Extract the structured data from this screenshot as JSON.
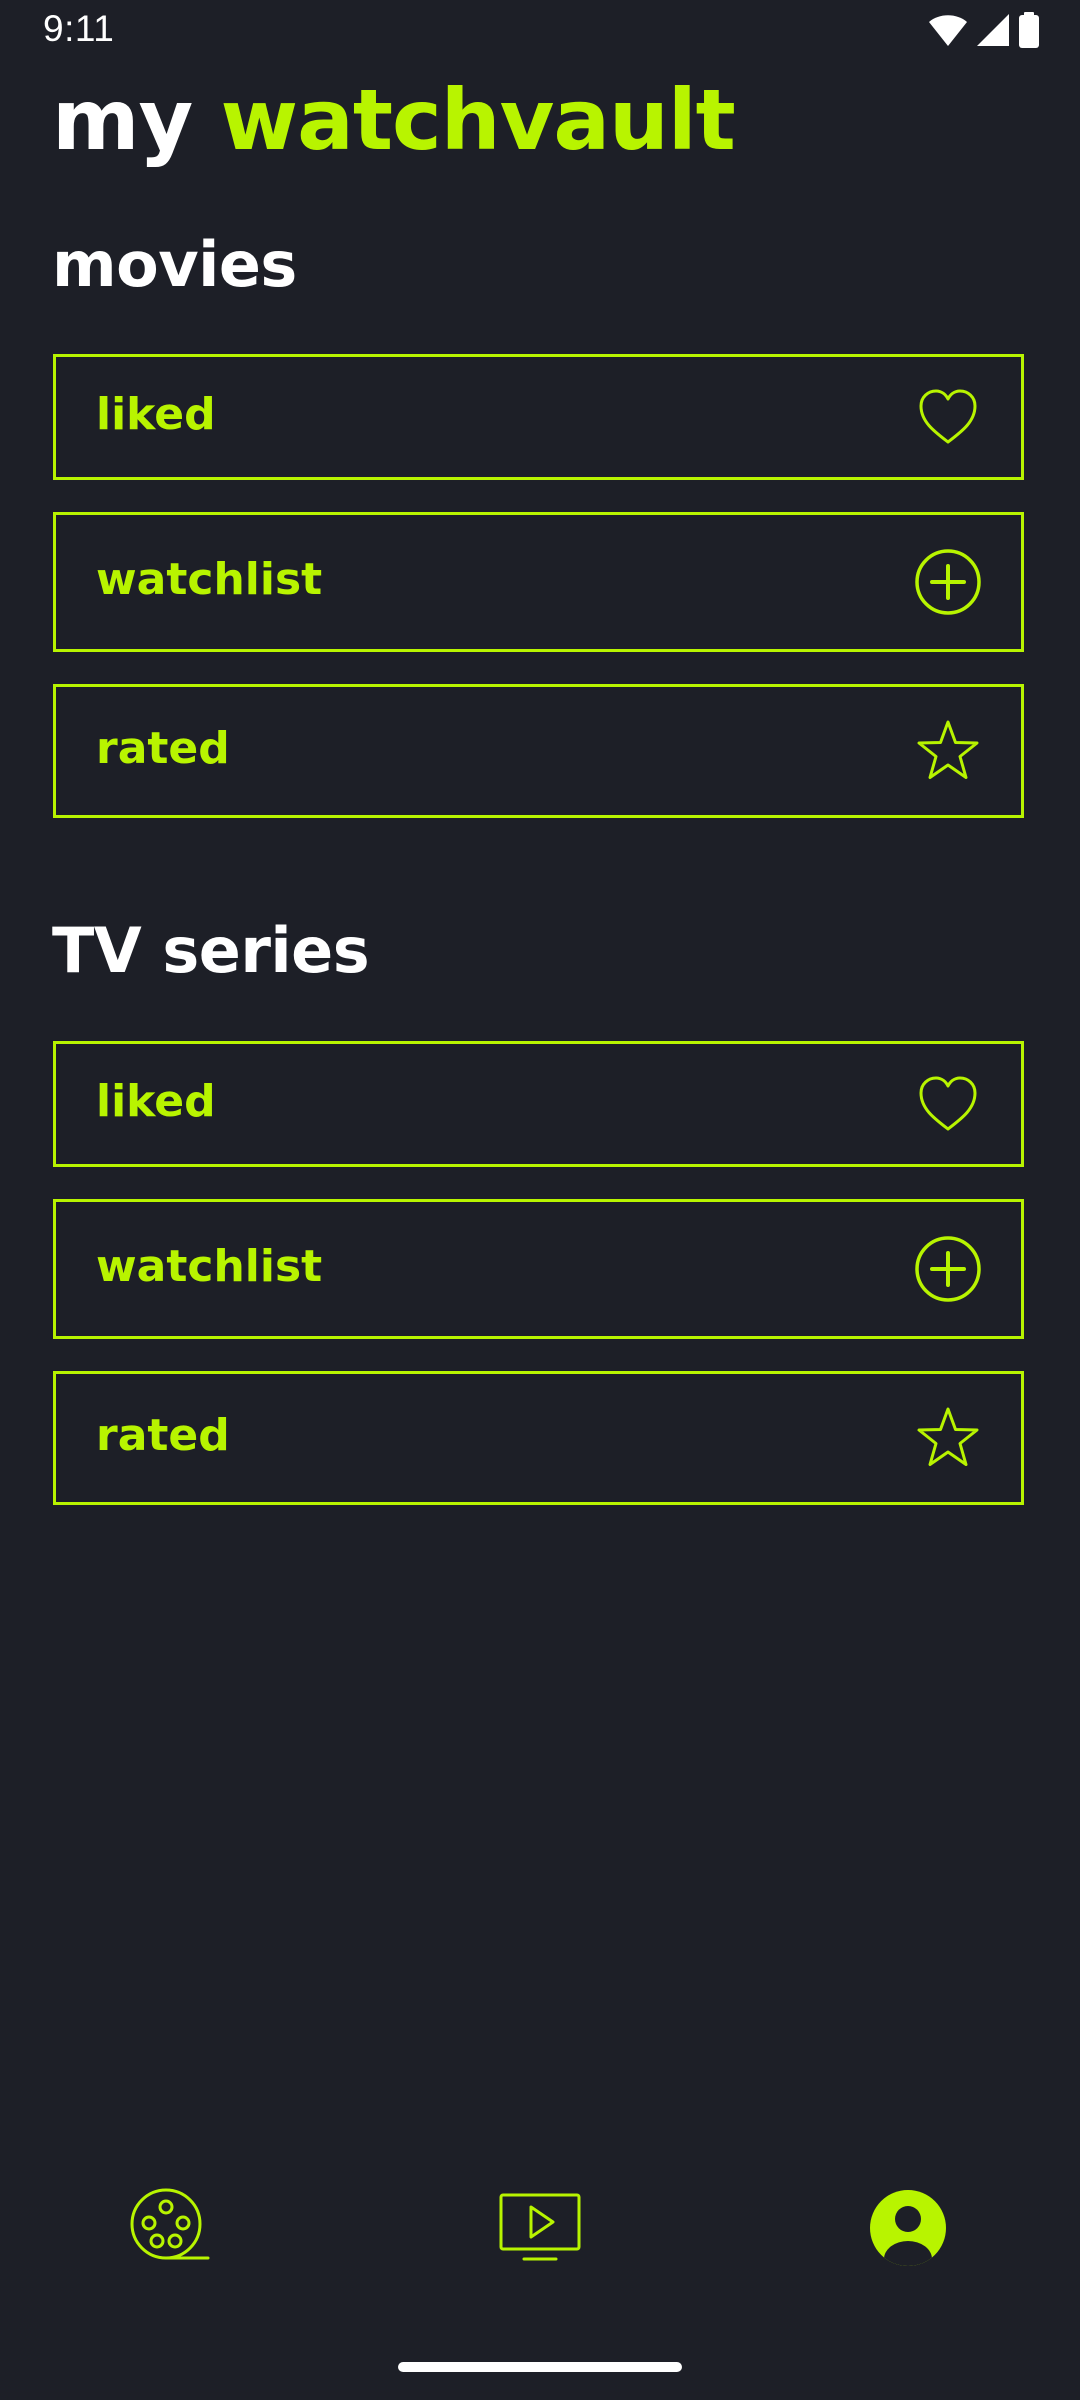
{
  "status_bar": {
    "time": "9:11",
    "icons": [
      "wifi-icon",
      "cellular-signal-icon",
      "battery-icon"
    ]
  },
  "header": {
    "title_prefix": "my",
    "title_brand": "watchvault"
  },
  "colors": {
    "accent": "#b8f400",
    "background": "#1d1f27",
    "text": "#ffffff"
  },
  "sections": [
    {
      "title": "movies",
      "items": [
        {
          "label": "liked",
          "icon": "heart-icon"
        },
        {
          "label": "watchlist",
          "icon": "plus-circle-icon"
        },
        {
          "label": "rated",
          "icon": "star-icon"
        }
      ]
    },
    {
      "title": "TV series",
      "items": [
        {
          "label": "liked",
          "icon": "heart-icon"
        },
        {
          "label": "watchlist",
          "icon": "plus-circle-icon"
        },
        {
          "label": "rated",
          "icon": "star-icon"
        }
      ]
    }
  ],
  "bottom_nav": {
    "items": [
      {
        "icon": "film-reel-icon",
        "active": false
      },
      {
        "icon": "tv-play-icon",
        "active": false
      },
      {
        "icon": "profile-icon",
        "active": true
      }
    ]
  }
}
